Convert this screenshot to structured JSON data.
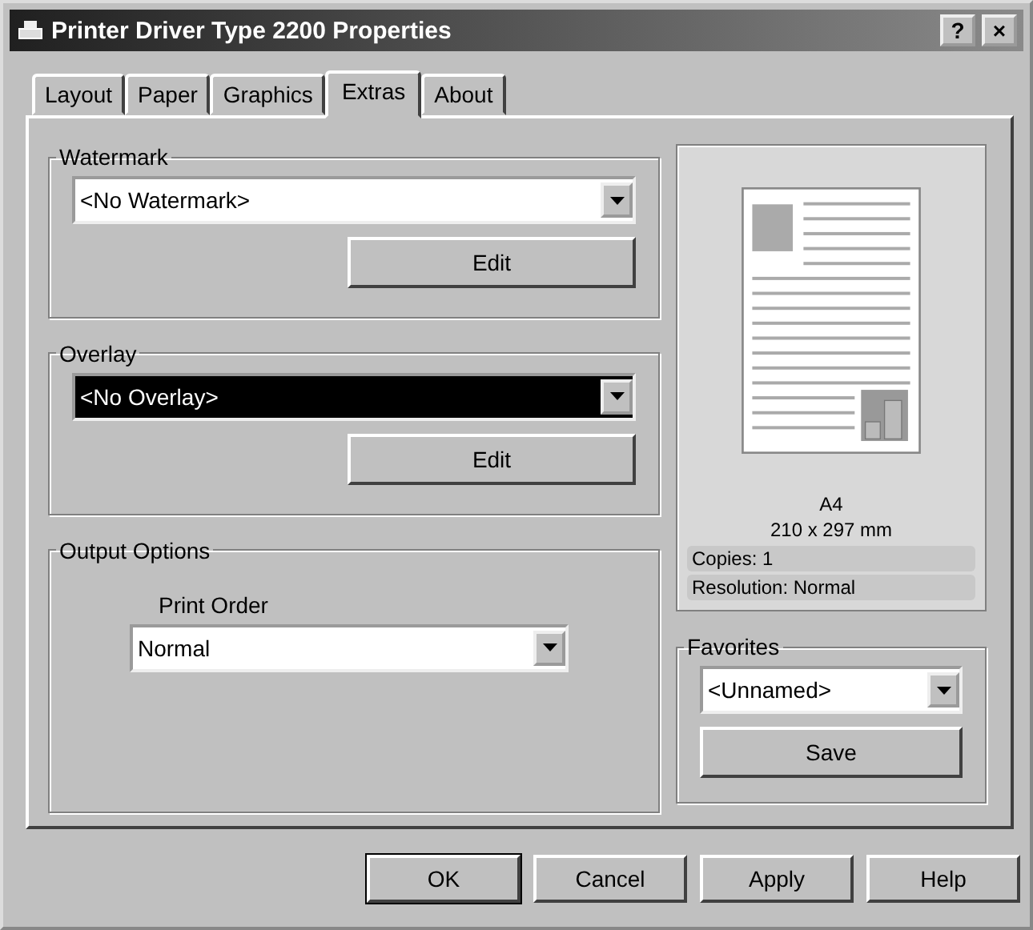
{
  "window": {
    "title": "Printer Driver Type 2200 Properties",
    "title_buttons": [
      "?",
      "×"
    ]
  },
  "tabs": [
    {
      "label": "Layout",
      "selected": false
    },
    {
      "label": "Paper",
      "selected": false
    },
    {
      "label": "Graphics",
      "selected": false
    },
    {
      "label": "Extras",
      "selected": true
    },
    {
      "label": "About",
      "selected": false
    }
  ],
  "watermark": {
    "title": "Watermark",
    "value": "<No Watermark>",
    "focused": false,
    "button": "Edit"
  },
  "overlay": {
    "title": "Overlay",
    "value": "<No Overlay>",
    "focused": true,
    "button": "Edit"
  },
  "output_options": {
    "title": "Output Options",
    "label": "Print Order",
    "value": "Normal"
  },
  "preview": {
    "paper": "A4",
    "size": "210 x 297 mm",
    "info": [
      "Copies: 1",
      "Resolution: Normal"
    ]
  },
  "favorites": {
    "title": "Favorites",
    "value": "<Unnamed>",
    "button": "Save"
  },
  "buttons": [
    {
      "label": "OK",
      "default": true
    },
    {
      "label": "Cancel",
      "default": false
    },
    {
      "label": "Apply",
      "default": false
    },
    {
      "label": "Help",
      "default": false
    }
  ]
}
